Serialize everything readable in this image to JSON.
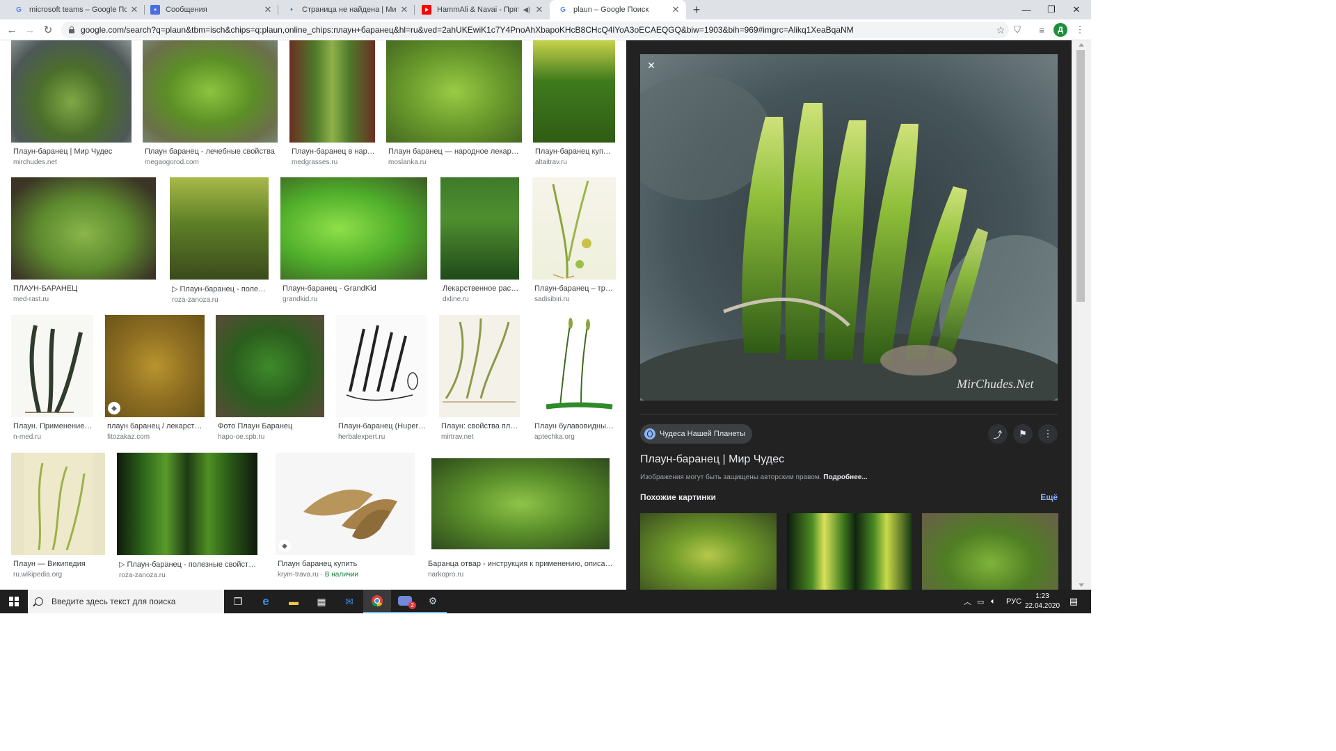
{
  "browser": {
    "tabs": [
      {
        "title": "microsoft teams – Google Поиск",
        "icon": "google-icon"
      },
      {
        "title": "Сообщения",
        "icon": "messages-icon"
      },
      {
        "title": "Страница не найдена | Мир Чудес",
        "icon": "loading-icon"
      },
      {
        "title": "HammAli & Navai - Прятки (",
        "icon": "youtube-icon",
        "audio": "speaker-icon"
      },
      {
        "title": "plaun – Google Поиск",
        "icon": "google-icon",
        "active": true
      }
    ],
    "url": "google.com/search?q=plaun&tbm=isch&chips=q:plaun,online_chips:плаун+баранец&hl=ru&ved=2ahUKEwiK1c7Y4PnoAhXbapoKHcB8CHcQ4lYoA3oECAEQGQ&biw=1903&bih=969#imgrc=Alikq1XeaBqaNM",
    "profile_initial": "Д"
  },
  "results": [
    {
      "title": "Плаун-баранец | Мир Чудес",
      "site": "mirchudes.net"
    },
    {
      "title": "Плаун баранец - лечебные свойства",
      "site": "megaogorod.com"
    },
    {
      "title": "Плаун-баранец в наро...",
      "site": "medgrasses.ru"
    },
    {
      "title": "Плаун баранец — народное лекарств...",
      "site": "moslanka.ru"
    },
    {
      "title": "Плаун-баранец купит...",
      "site": "altaitrav.ru"
    },
    {
      "title": "ПЛАУН-БАРАНЕЦ",
      "site": "med-rast.ru"
    },
    {
      "title": "▷ Плаун-баранец - полезн...",
      "site": "roza-zanoza.ru"
    },
    {
      "title": "Плаун-баранец - GrandKid",
      "site": "grandkid.ru"
    },
    {
      "title": "Лекарственное расте...",
      "site": "dxline.ru"
    },
    {
      "title": "Плаун-баранец – трав...",
      "site": "sadisibiri.ru"
    },
    {
      "title": "Плаун. Применение п...",
      "site": "n-med.ru"
    },
    {
      "title": "плаун баранец / лекарстве...",
      "site": "fitozakaz.com"
    },
    {
      "title": "Фото Плаун Баранец",
      "site": "hapo-oe.spb.ru"
    },
    {
      "title": "Плаун-баранец (Huperzia...",
      "site": "herbalexpert.ru"
    },
    {
      "title": "Плаун: свойства плау...",
      "site": "mirtrav.net"
    },
    {
      "title": "Плаун булавовидный ...",
      "site": "aptechka.org"
    },
    {
      "title": "Плаун — Википедия",
      "site": "ru.wikipedia.org"
    },
    {
      "title": "▷ Плаун-баранец - полезные свойства, о...",
      "site": "roza-zanoza.ru"
    },
    {
      "title": "Плаун баранец купить",
      "site": "krym-trava.ru",
      "stock": "В наличии"
    },
    {
      "title": "Баранца отвар - инструкция к применению, описание ...",
      "site": "narkopro.ru"
    }
  ],
  "preview": {
    "source_chip": "Чудеса Нашей Планеты",
    "title": "Плаун-баранец | Мир Чудес",
    "copyright": "Изображения могут быть защищены авторским правом.",
    "more_link": "Подробнее...",
    "similar_heading": "Похожие картинки",
    "more_button": "Ещё",
    "watermark": "MirChudes.Net"
  },
  "taskbar": {
    "search_placeholder": "Введите здесь текст для поиска",
    "language": "РУС",
    "time": "1:23",
    "date": "22.04.2020",
    "notification_count": "2"
  }
}
